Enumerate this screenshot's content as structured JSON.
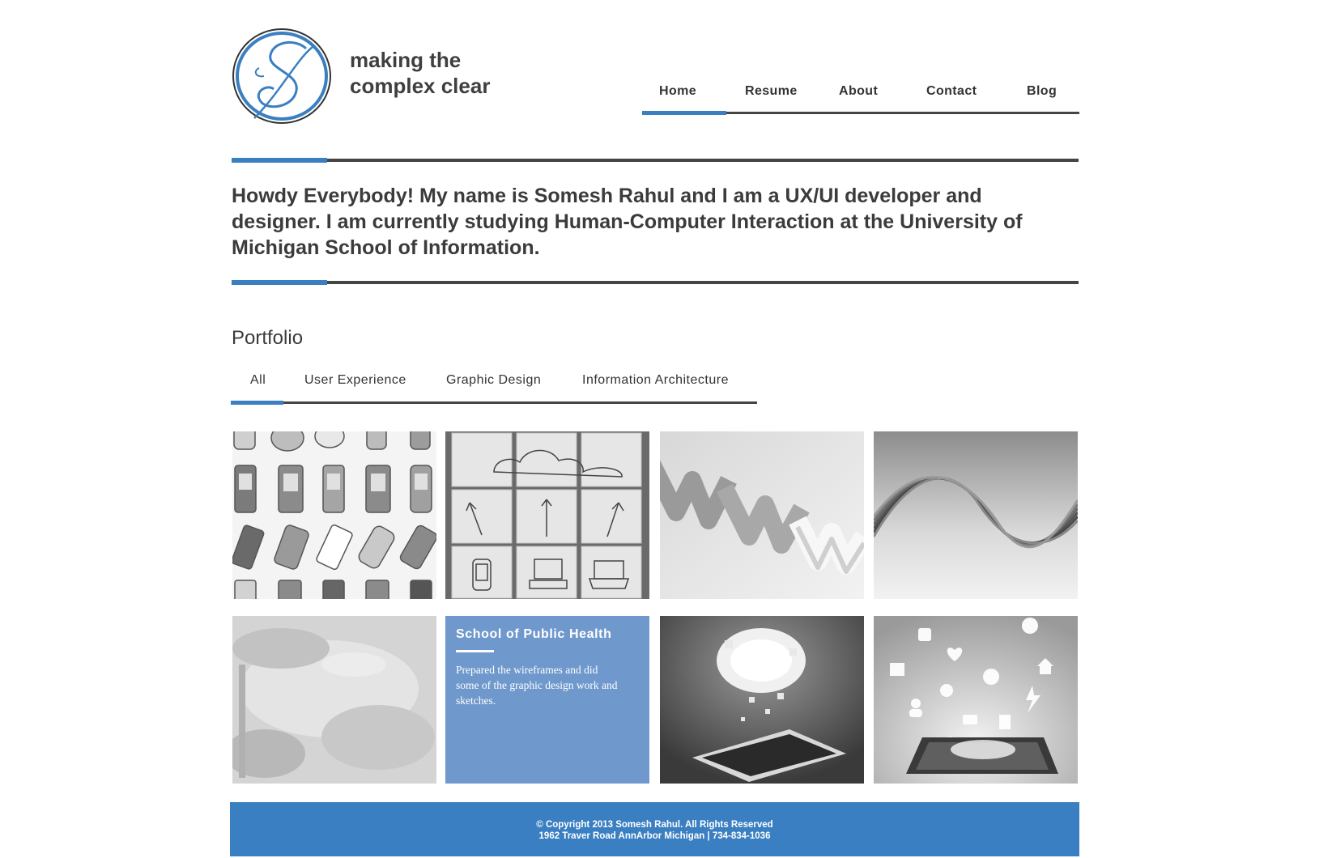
{
  "header": {
    "tagline_line1": "making the",
    "tagline_line2": "complex clear",
    "logo_icon": "script-s-logo-icon"
  },
  "nav": {
    "items": [
      {
        "label": "Home",
        "active": true
      },
      {
        "label": "Resume",
        "active": false
      },
      {
        "label": "About",
        "active": false
      },
      {
        "label": "Contact",
        "active": false
      },
      {
        "label": "Blog",
        "active": false
      }
    ]
  },
  "intro": {
    "text": "Howdy Everybody! My name is Somesh Rahul and I am a UX/UI developer and designer. I am currently studying Human-Computer Interaction at the University of Michigan School of Information."
  },
  "portfolio": {
    "title": "Portfolio",
    "filters": [
      {
        "label": "All",
        "active": true
      },
      {
        "label": "User Experience",
        "active": false
      },
      {
        "label": "Graphic Design",
        "active": false
      },
      {
        "label": "Information Architecture",
        "active": false
      }
    ],
    "tiles": [
      {
        "image": "mobile-phones-icon-grid"
      },
      {
        "image": "sketch-notes-wireframe"
      },
      {
        "image": "www-3d-letters"
      },
      {
        "image": "abstract-wave"
      },
      {
        "image": "watercolor-texture"
      },
      {
        "image": "school-of-public-health",
        "title": "School of Public Health",
        "description": "Prepared the wireframes and did some of the graphic design work and sketches."
      },
      {
        "image": "tablet-exploding-cubes"
      },
      {
        "image": "tablet-app-icons"
      }
    ]
  },
  "footer": {
    "copyright": "© Copyright 2013 Somesh Rahul. All Rights Reserved",
    "address": "1962 Traver Road AnnArbor Michigan | 734-834-1036"
  },
  "colors": {
    "accent": "#3a7fc1",
    "rule": "#454545",
    "text": "#3b3b3b",
    "overlay": "#6f98cc"
  }
}
